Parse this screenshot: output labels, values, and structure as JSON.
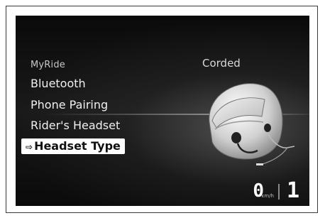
{
  "menu": {
    "section_title": "MyRide",
    "items": [
      {
        "label": "Bluetooth"
      },
      {
        "label": "Phone Pairing"
      },
      {
        "label": "Rider's Headset"
      }
    ],
    "selected": {
      "label": "Headset Type",
      "arrow": "⇨"
    }
  },
  "current_value": "Corded",
  "status": {
    "speed": "0",
    "speed_unit": "km/h",
    "gear": "1"
  },
  "icons": {
    "helmet": "helmet-with-corded-headset-icon",
    "selection": "selection-arrow-icon"
  },
  "colors": {
    "screen_bg": "#000000",
    "selected_bg": "#ffffff",
    "text": "#f0f0f0"
  }
}
